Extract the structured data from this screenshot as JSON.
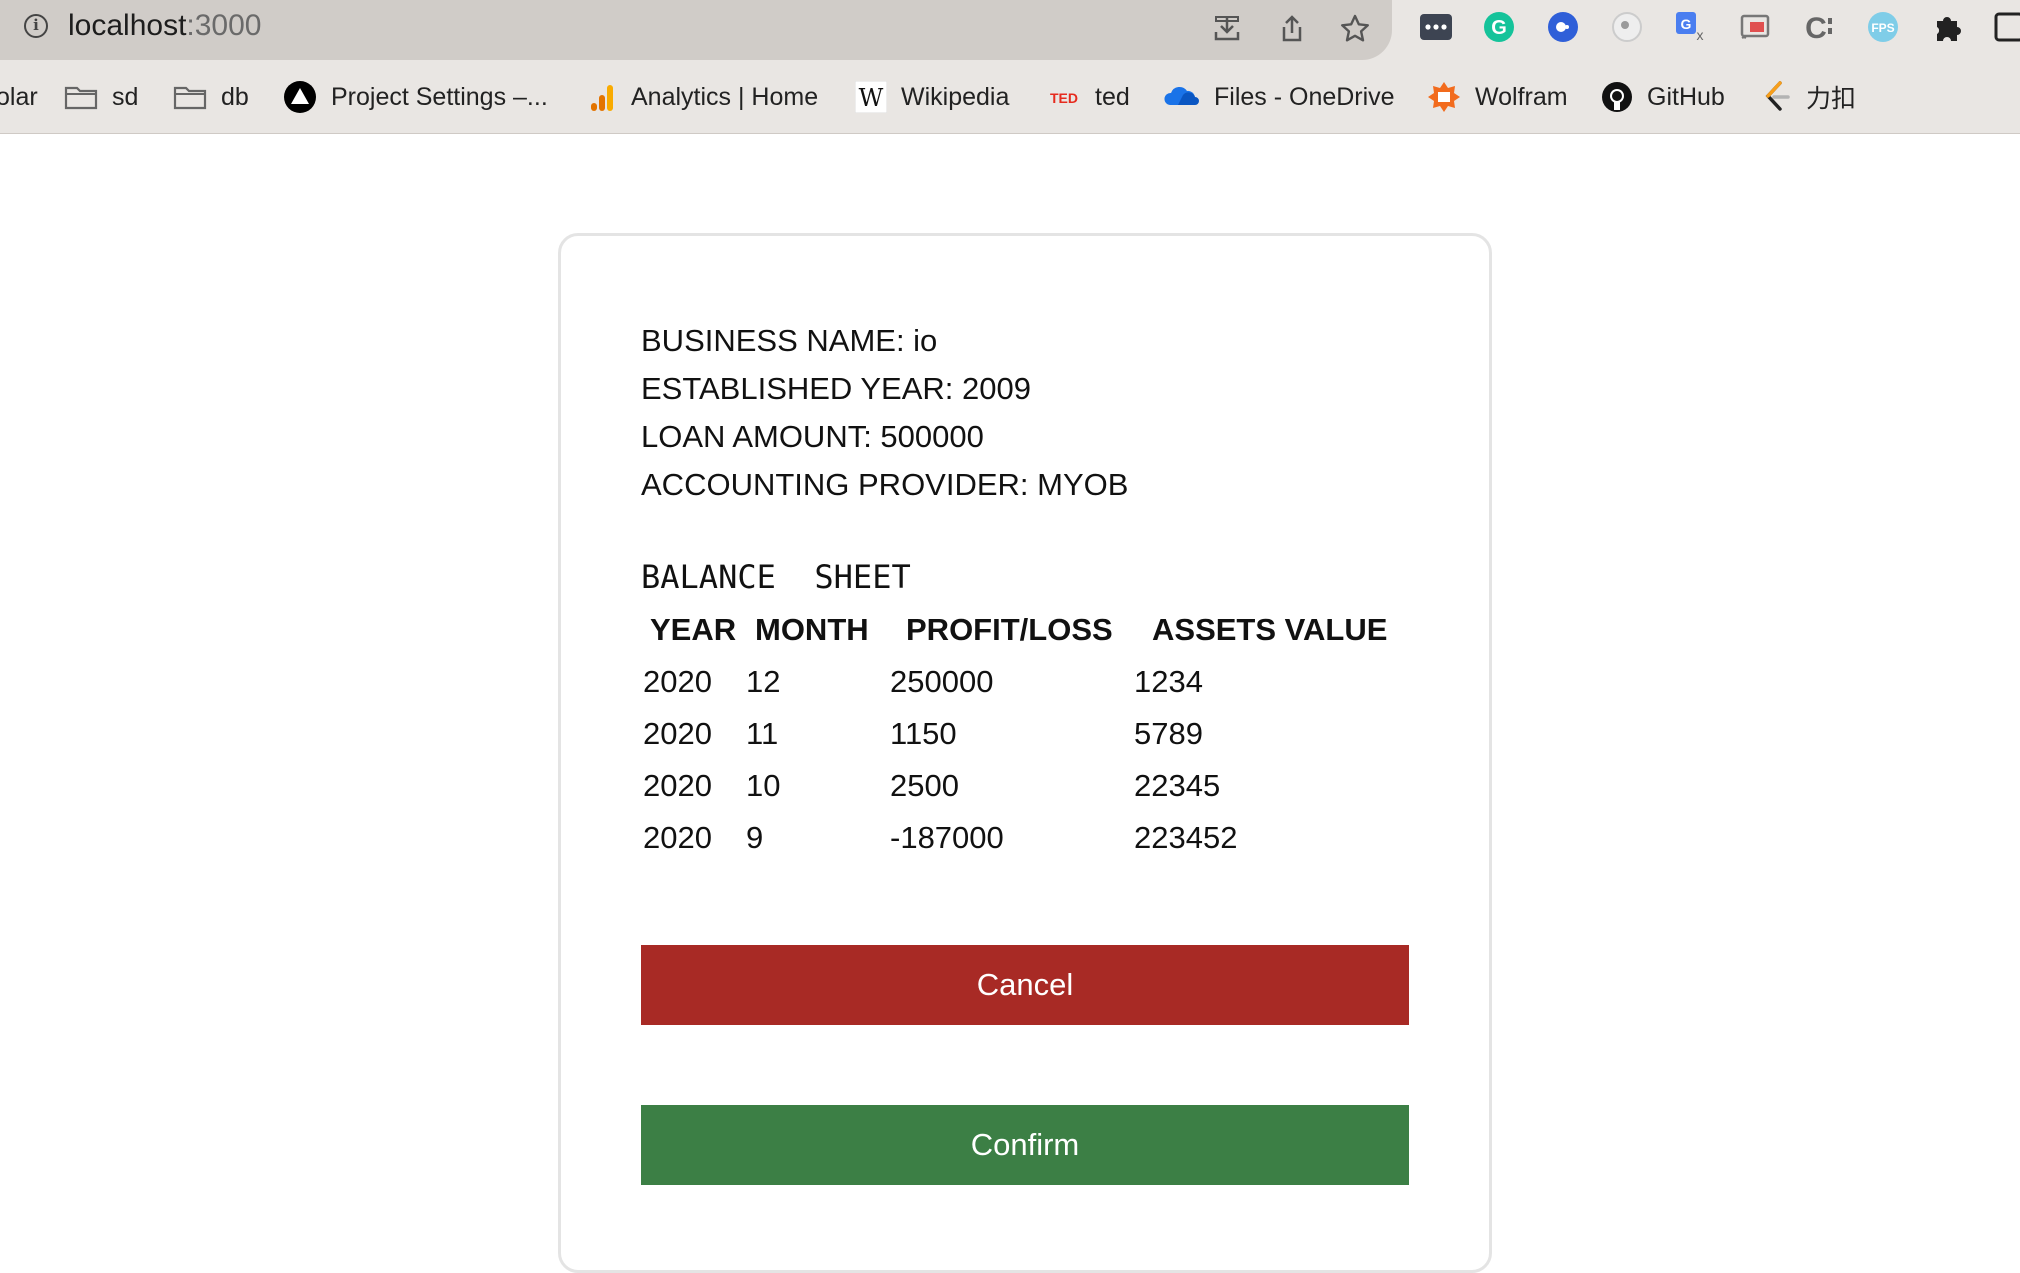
{
  "browser": {
    "url_host": "localhost",
    "url_port": ":3000",
    "bookmarks": [
      {
        "label": "olar",
        "icon": "none"
      },
      {
        "label": "sd",
        "icon": "folder-icon"
      },
      {
        "label": "db",
        "icon": "folder-icon"
      },
      {
        "label": "Project Settings –...",
        "icon": "vercel-icon"
      },
      {
        "label": "Analytics | Home",
        "icon": "analytics-icon"
      },
      {
        "label": "Wikipedia",
        "icon": "wikipedia-icon"
      },
      {
        "label": "ted",
        "icon": "ted-icon"
      },
      {
        "label": "Files - OneDrive",
        "icon": "onedrive-icon"
      },
      {
        "label": "Wolfram",
        "icon": "wolfram-icon"
      },
      {
        "label": "GitHub",
        "icon": "github-icon"
      },
      {
        "label": "力扣",
        "icon": "leetcode-icon"
      }
    ],
    "ted_logo_text": "TED",
    "wiki_logo_text": "W",
    "fps_badge": "FPS"
  },
  "summary": {
    "business_name": "BUSINESS NAME: io",
    "established_year": "ESTABLISHED YEAR: 2009",
    "loan_amount": "LOAN AMOUNT: 500000",
    "accounting_provider": "ACCOUNTING PROVIDER: MYOB"
  },
  "balance_sheet": {
    "title": "BALANCE  SHEET",
    "headers": [
      "YEAR",
      "MONTH",
      "PROFIT/LOSS",
      "ASSETS VALUE"
    ],
    "rows": [
      [
        "2020",
        "12",
        "250000",
        "1234"
      ],
      [
        "2020",
        "11",
        "1150",
        "5789"
      ],
      [
        "2020",
        "10",
        "2500",
        "22345"
      ],
      [
        "2020",
        "9",
        "-187000",
        "223452"
      ]
    ]
  },
  "actions": {
    "cancel_label": "Cancel",
    "confirm_label": "Confirm"
  },
  "colors": {
    "cancel": "#a82a25",
    "confirm": "#3c7f45"
  }
}
